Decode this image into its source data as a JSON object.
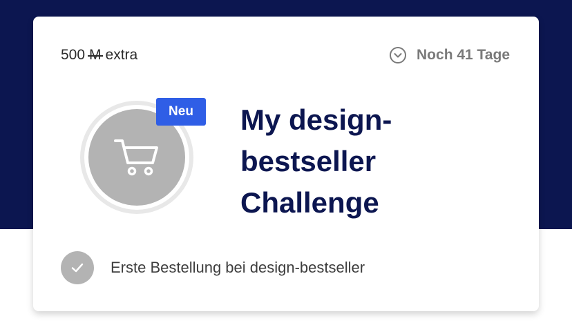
{
  "reward": {
    "amount": "500",
    "symbol": "M",
    "suffix": "extra"
  },
  "deadline": {
    "text": "Noch 41 Tage",
    "icon": "clock-icon"
  },
  "badge": {
    "tag": "Neu",
    "icon": "shopping-cart-icon"
  },
  "challenge": {
    "title": "My design-bestseller Challenge"
  },
  "tasks": [
    {
      "label": "Erste Bestellung bei design-bestseller",
      "icon": "checkmark-icon"
    }
  ],
  "colors": {
    "header_bg": "#0c1650",
    "title": "#0c1650",
    "tag_bg": "#2f5ee6",
    "placeholder_gray": "#b3b3b3"
  }
}
